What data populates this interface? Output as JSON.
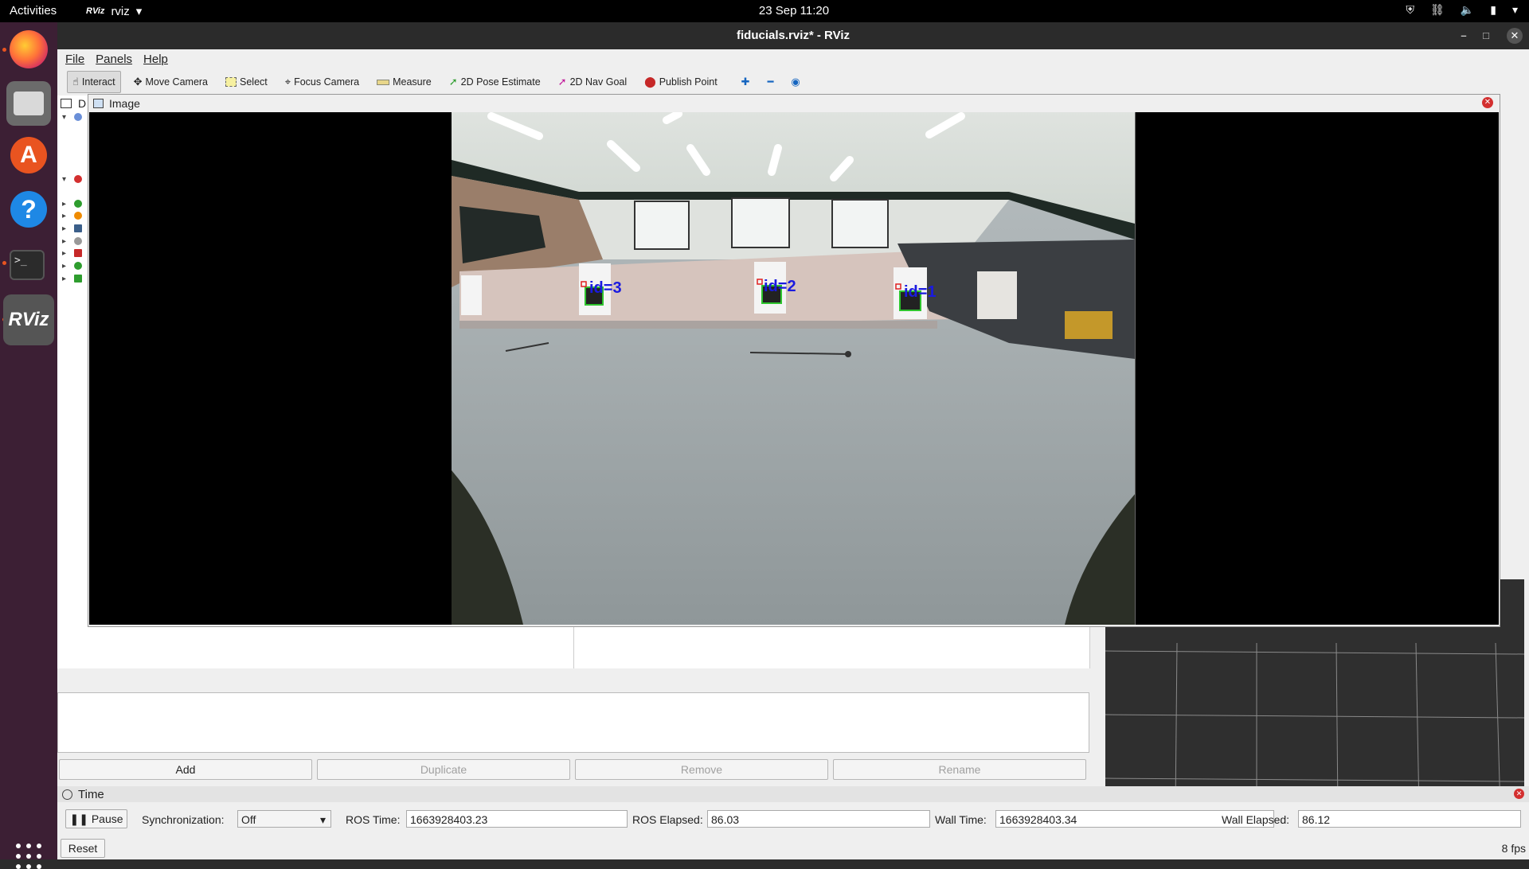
{
  "topbar": {
    "activities": "Activities",
    "app_logo": "RViz",
    "app_name": "rviz",
    "clock": "23 Sep  11:20"
  },
  "window": {
    "title": "fiducials.rviz* - RViz"
  },
  "menu": {
    "file": "File",
    "panels": "Panels",
    "help": "Help"
  },
  "toolbar": {
    "interact": "Interact",
    "move_camera": "Move Camera",
    "select": "Select",
    "focus_camera": "Focus Camera",
    "measure": "Measure",
    "pose_estimate": "2D Pose Estimate",
    "nav_goal": "2D Nav Goal",
    "publish_point": "Publish Point"
  },
  "image_panel": {
    "title": "Image",
    "marker_labels": [
      "id=3",
      "id=2",
      "id=1"
    ]
  },
  "displays_panel": {
    "header_letter": "D",
    "buttons": {
      "add": "Add",
      "duplicate": "Duplicate",
      "remove": "Remove",
      "rename": "Rename"
    }
  },
  "time_panel": {
    "title": "Time",
    "pause": "Pause",
    "sync_label": "Synchronization:",
    "sync_value": "Off",
    "ros_time_label": "ROS Time:",
    "ros_time": "1663928403.23",
    "ros_elapsed_label": "ROS Elapsed:",
    "ros_elapsed": "86.03",
    "wall_time_label": "Wall Time:",
    "wall_time": "1663928403.34",
    "wall_elapsed_label": "Wall Elapsed:",
    "wall_elapsed": "86.12",
    "reset": "Reset",
    "fps": "8 fps"
  },
  "dock_logo": "RViz",
  "colors": {
    "dock_bg": "#3c1f34",
    "accent": "#e95420",
    "marker_label": "#1a1ae0"
  }
}
